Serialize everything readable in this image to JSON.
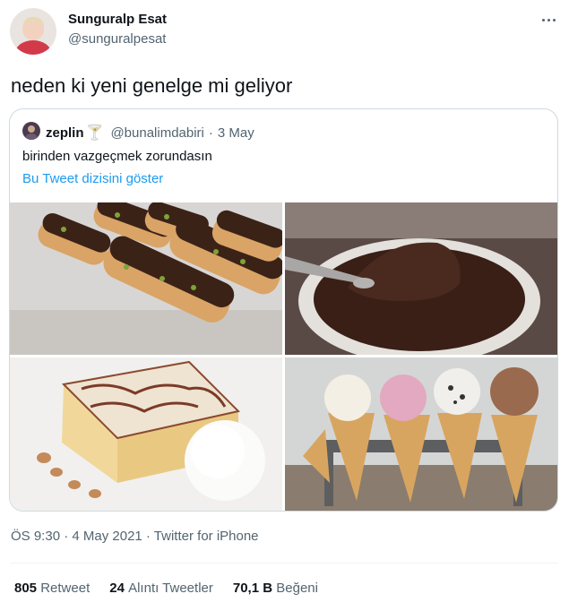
{
  "tweet": {
    "author_name": "Sunguralp Esat",
    "author_handle": "@sunguralpesat",
    "text": "neden ki yeni genelge mi geliyor",
    "timestamp": "ÖS 9:30 · 4 May 2021 · Twitter for iPhone"
  },
  "quoted": {
    "author_name": "zeplin",
    "emoji": "🍸",
    "author_handle": "@bunalimdabiri",
    "separator": "·",
    "date": "3 May",
    "text": "birinden vazgeçmek zorundasın",
    "thread_link": "Bu Tweet dizisini göster",
    "images": [
      "eclair-dessert",
      "chocolate-lava-cake",
      "trilece-cake-with-ice-cream",
      "ice-cream-cones"
    ]
  },
  "stats": [
    {
      "count": "805",
      "label": "Retweet"
    },
    {
      "count": "24",
      "label": "Alıntı Tweetler"
    },
    {
      "count": "70,1 B",
      "label": "Beğeni"
    }
  ],
  "icons": {
    "more": "more-dots-icon"
  },
  "colors": {
    "link": "#1d9bf0",
    "secondary_text": "#536471",
    "border": "#cfd9de"
  }
}
